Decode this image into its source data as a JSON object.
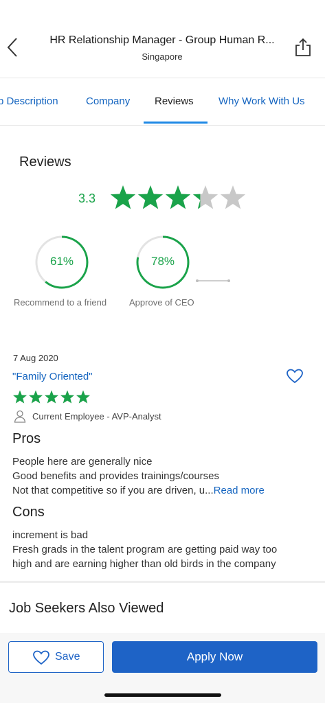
{
  "header": {
    "title": "HR Relationship Manager - Group Human R...",
    "location": "Singapore"
  },
  "tabs": [
    {
      "label": "b Description"
    },
    {
      "label": "Company"
    },
    {
      "label": "Reviews",
      "active": true
    },
    {
      "label": "Why Work With Us"
    }
  ],
  "reviews": {
    "section_title": "Reviews",
    "overall_rating": "3.3",
    "stars_value": 3.3,
    "recommend": {
      "value": "61%",
      "fraction": 0.61,
      "label": "Recommend to a friend"
    },
    "ceo": {
      "value": "78%",
      "fraction": 0.78,
      "label": "Approve of CEO"
    }
  },
  "review": {
    "date": "7 Aug 2020",
    "title": "\"Family Oriented\"",
    "stars": 5,
    "employee": "Current Employee - AVP-Analyst",
    "pros_heading": "Pros",
    "pros_lines": [
      "People here are generally nice",
      "Good benefits and provides trainings/courses",
      "Not that competitive so if you are driven, u..."
    ],
    "read_more": "Read more",
    "cons_heading": "Cons",
    "cons_lines": [
      "increment is bad",
      "Fresh grads in the talent program are getting paid way too",
      "high and are earning higher than old birds in the company"
    ]
  },
  "also_viewed": "Job Seekers Also Viewed",
  "actions": {
    "save_label": "Save",
    "apply_label": "Apply Now"
  },
  "colors": {
    "green": "#1aa34a",
    "blue": "#1565c0",
    "button_blue": "#1e63c6",
    "star_gray": "#c8c8c8"
  },
  "icons": [
    "chevron-left-icon",
    "share-icon",
    "star-icon",
    "heart-icon",
    "person-icon"
  ]
}
